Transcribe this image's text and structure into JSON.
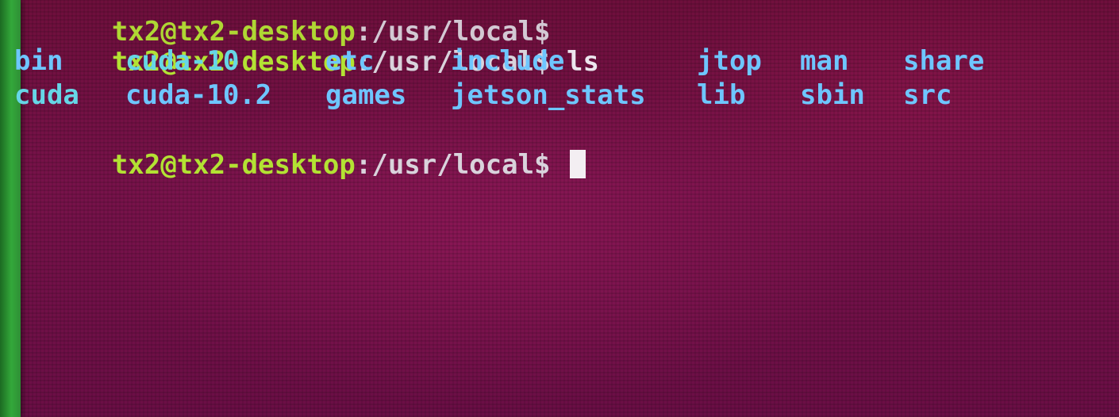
{
  "terminal": {
    "prev_line": {
      "user_host": "tx2@tx2-desktop",
      "path": ":/usr/local$ "
    },
    "line1": {
      "user_host": "tx2@tx2-desktop",
      "path": ":/usr/local$ ",
      "command": "ls"
    },
    "listing": {
      "row1": [
        "bin",
        "cuda-10",
        "etc",
        "include",
        "jtop",
        "man",
        "share"
      ],
      "row2": [
        "cuda",
        "cuda-10.2",
        "games",
        "jetson_stats",
        "lib",
        "sbin",
        "src"
      ]
    },
    "line3": {
      "user_host": "tx2@tx2-desktop",
      "path": ":/usr/local$ "
    },
    "colors": {
      "background": "#77124a",
      "prompt_user": "#b3e233",
      "directory": "#6ec6ff",
      "symlink": "#66d6e6",
      "text": "#e9e3ea"
    }
  }
}
